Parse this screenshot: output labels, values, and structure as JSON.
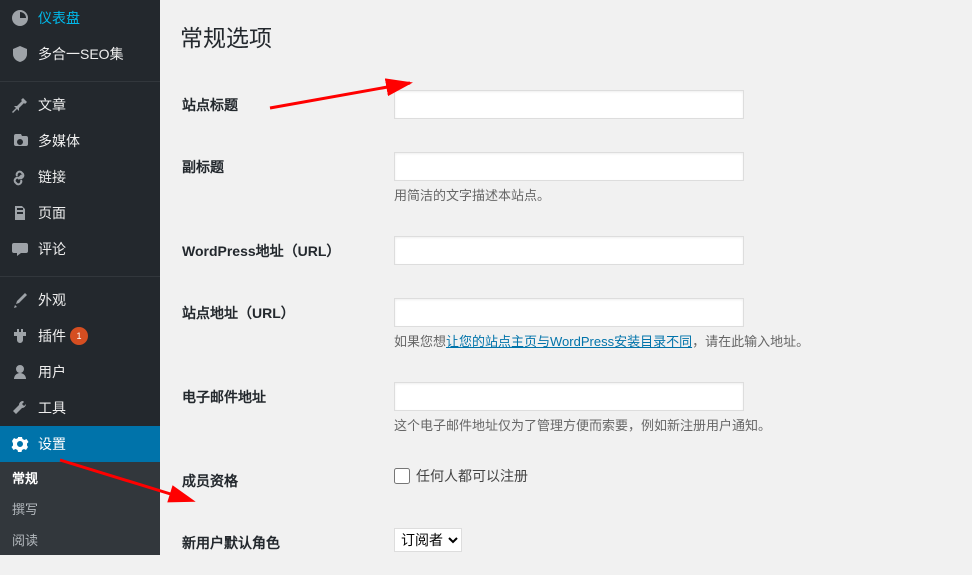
{
  "sidebar": {
    "items": [
      {
        "label": "仪表盘",
        "icon": "dashboard"
      },
      {
        "label": "多合一SEO集",
        "icon": "shield"
      },
      {
        "label": "文章",
        "icon": "pin"
      },
      {
        "label": "多媒体",
        "icon": "media"
      },
      {
        "label": "链接",
        "icon": "link"
      },
      {
        "label": "页面",
        "icon": "page"
      },
      {
        "label": "评论",
        "icon": "comment"
      },
      {
        "label": "外观",
        "icon": "brush"
      },
      {
        "label": "插件",
        "icon": "plugin",
        "badge": "1"
      },
      {
        "label": "用户",
        "icon": "user"
      },
      {
        "label": "工具",
        "icon": "tool"
      },
      {
        "label": "设置",
        "icon": "settings"
      }
    ],
    "submenu": [
      {
        "label": "常规"
      },
      {
        "label": "撰写"
      },
      {
        "label": "阅读"
      }
    ]
  },
  "page": {
    "title": "常规选项"
  },
  "form": {
    "site_title": {
      "label": "站点标题",
      "value": ""
    },
    "tagline": {
      "label": "副标题",
      "value": "",
      "description": "用简洁的文字描述本站点。"
    },
    "wp_url": {
      "label": "WordPress地址（URL）",
      "value": ""
    },
    "site_url": {
      "label": "站点地址（URL）",
      "value": "",
      "description_prefix": "如果您想",
      "description_link": "让您的站点主页与WordPress安装目录不同",
      "description_suffix": "，请在此输入地址。"
    },
    "email": {
      "label": "电子邮件地址",
      "value": "",
      "description": "这个电子邮件地址仅为了管理方便而索要，例如新注册用户通知。"
    },
    "membership": {
      "label": "成员资格",
      "checkbox_label": "任何人都可以注册"
    },
    "default_role": {
      "label": "新用户默认角色",
      "selected": "订阅者"
    }
  }
}
